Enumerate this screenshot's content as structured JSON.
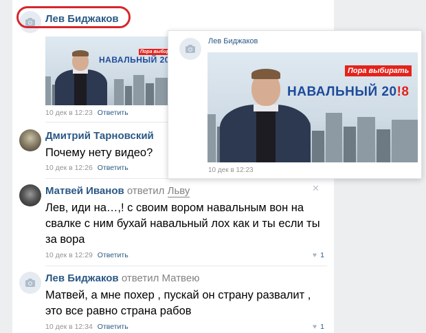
{
  "comments": [
    {
      "author": "Лев Биджаков",
      "date": "10 дек в 12:23",
      "reply_label": "Ответить"
    },
    {
      "author": "Дмитрий Тарновский",
      "text": "Почему нету видео?",
      "date": "10 дек в 12:26",
      "reply_label": "Ответить"
    },
    {
      "author": "Матвей Иванов",
      "reply_note": "ответил",
      "reply_to": "Льву",
      "text": "Лев, иди на…,! с своим вором навальным вон на свалке с ним бухай навальный лох как и ты если ты за вора",
      "date": "10 дек в 12:29",
      "reply_label": "Ответить",
      "likes": "1"
    },
    {
      "author": "Лев Биджаков",
      "reply_note": "ответил",
      "reply_to": "Матвею",
      "text": "Матвей, а мне похер , пускай он страну развалит , это все равно страна рабов",
      "date": "10 дек в 12:34",
      "reply_label": "Ответить",
      "likes": "1"
    }
  ],
  "banner": {
    "slogan": "Пора выбирать",
    "name": "НАВАЛЬНЫЙ 20",
    "year": "!8"
  },
  "popup": {
    "author": "Лев Биджаков",
    "date": "10 дек в 12:23"
  },
  "icons": {
    "camera": "camera-icon",
    "heart": "heart-icon",
    "close": "close-icon"
  },
  "colors": {
    "link": "#2a5885",
    "highlight": "#d6262c",
    "slogan_bg": "#e3231c"
  }
}
